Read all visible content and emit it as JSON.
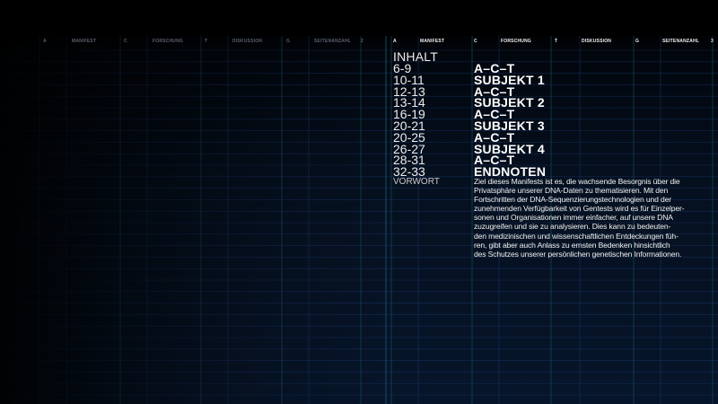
{
  "header": {
    "left": {
      "items": [
        "A",
        "MANIFEST",
        "C",
        "FORSCHUNG",
        "T",
        "DISKUSSION",
        "G",
        "SEITENANZAHL",
        "2"
      ]
    },
    "right": {
      "items": [
        "A",
        "MANIFEST",
        "C",
        "FORSCHUNG",
        "T",
        "DISKUSSION",
        "G",
        "SEITENANZAHL",
        "3"
      ]
    }
  },
  "toc": {
    "title": "INHALT",
    "rows": [
      {
        "pages": "6-9",
        "subject": "A–C–T"
      },
      {
        "pages": "10-11",
        "subject": "SUBJEKT 1"
      },
      {
        "pages": "12-13",
        "subject": "A–C–T"
      },
      {
        "pages": "13-14",
        "subject": "SUBJEKT 2"
      },
      {
        "pages": "16-19",
        "subject": "A–C–T"
      },
      {
        "pages": "20-21",
        "subject": "SUBJEKT 3"
      },
      {
        "pages": "20-25",
        "subject": "A–C–T"
      },
      {
        "pages": "26-27",
        "subject": "SUBJEKT 4"
      },
      {
        "pages": "28-31",
        "subject": "A–C–T"
      },
      {
        "pages": "32-33",
        "subject": "ENDNOTEN"
      }
    ]
  },
  "foreword": {
    "label": "VORWORT",
    "lines": [
      "Ziel dieses Manifests ist es, die wachsende Besorgnis über die",
      "Privatsphäre unserer DNA-Daten zu thematisieren. Mit den",
      "Fortschritten der DNA-Sequenzierungstechnologien und der",
      "zunehmenden Verfügbarkeit von Gentests wird es für Einzelper-",
      "sonen und Organisationen immer einfacher, auf unsere DNA",
      "zuzugreifen und sie zu analysieren. Dies kann zu bedeuten-",
      "den medizinischen und wissenschaftlichen Entdeckungen füh-",
      "ren, gibt aber auch Anlass zu ernsten Bedenken hinsichtlich",
      "des Schutzes unserer persönlichen genetischen Informationen."
    ]
  },
  "colors": {
    "background": "#000000",
    "grid_blue": "#1c3f7a",
    "grid_cyan": "#1f6f82",
    "text": "#ececec"
  }
}
